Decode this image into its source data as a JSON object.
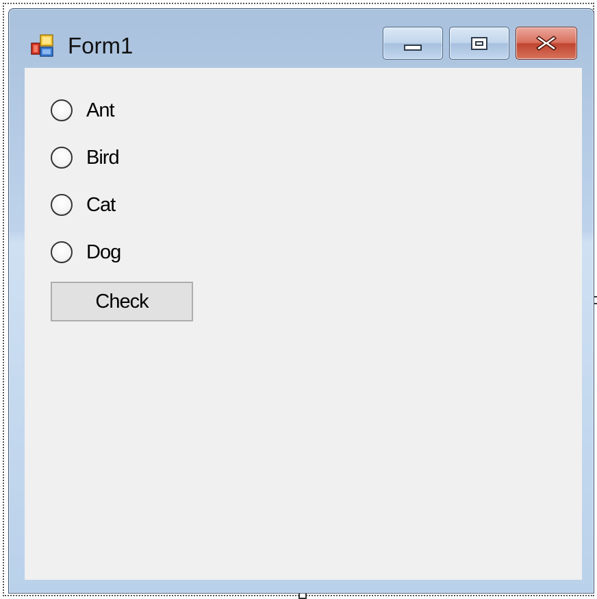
{
  "window": {
    "title": "Form1",
    "app_icon": "winforms-app-icon",
    "controls": {
      "minimize_icon": "minimize-icon",
      "maximize_icon": "maximize-icon",
      "close_icon": "close-icon"
    }
  },
  "form": {
    "radios": [
      {
        "label": "Ant",
        "checked": false
      },
      {
        "label": "Bird",
        "checked": false
      },
      {
        "label": "Cat",
        "checked": false
      },
      {
        "label": "Dog",
        "checked": false
      }
    ],
    "check_button_label": "Check"
  },
  "colors": {
    "client_background": "#f0f0f0",
    "button_background": "#e1e1e1",
    "close_button_red": "#c04530",
    "title_bar_blue": "#bed3eb"
  }
}
